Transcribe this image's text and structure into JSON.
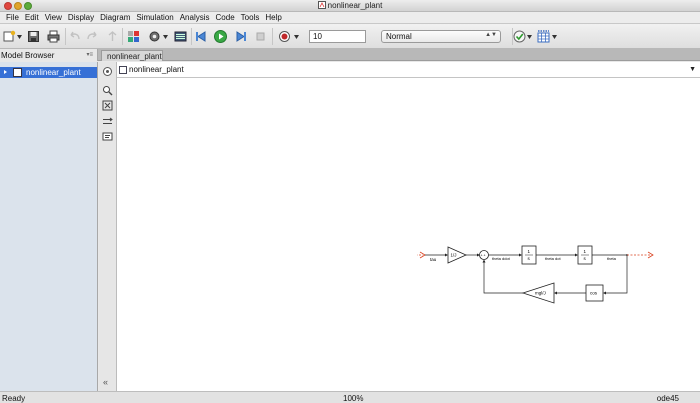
{
  "window": {
    "title": "nonlinear_plant"
  },
  "menu": [
    "File",
    "Edit",
    "View",
    "Display",
    "Diagram",
    "Simulation",
    "Analysis",
    "Code",
    "Tools",
    "Help"
  ],
  "toolbar": {
    "stop_time": "10",
    "sim_mode": "Normal"
  },
  "model_browser": {
    "title": "Model Browser",
    "items": [
      {
        "label": "nonlinear_plant",
        "selected": true
      }
    ]
  },
  "tabs": [
    {
      "label": "nonlinear_plant",
      "active": true
    }
  ],
  "address_bar": {
    "path": "nonlinear_plant"
  },
  "diagram": {
    "input_label": "tau",
    "gain_in": "1/J",
    "sum_signs": "+ +",
    "integrator1": {
      "num": "1",
      "den": "s"
    },
    "integrator2": {
      "num": "1",
      "den": "s"
    },
    "signal_theta_ddot": "theta ddot",
    "signal_theta_dot": "theta dot",
    "signal_theta": "theta",
    "gain_feedback": "mgl/J",
    "fcn_block": "cos"
  },
  "status": {
    "state": "Ready",
    "zoom": "100%",
    "solver": "ode45"
  },
  "colors": {
    "selection": "#3670d6",
    "browser_bg": "#dbe3ec",
    "signal_port": "#d9401e",
    "run_button": "#39a845"
  }
}
